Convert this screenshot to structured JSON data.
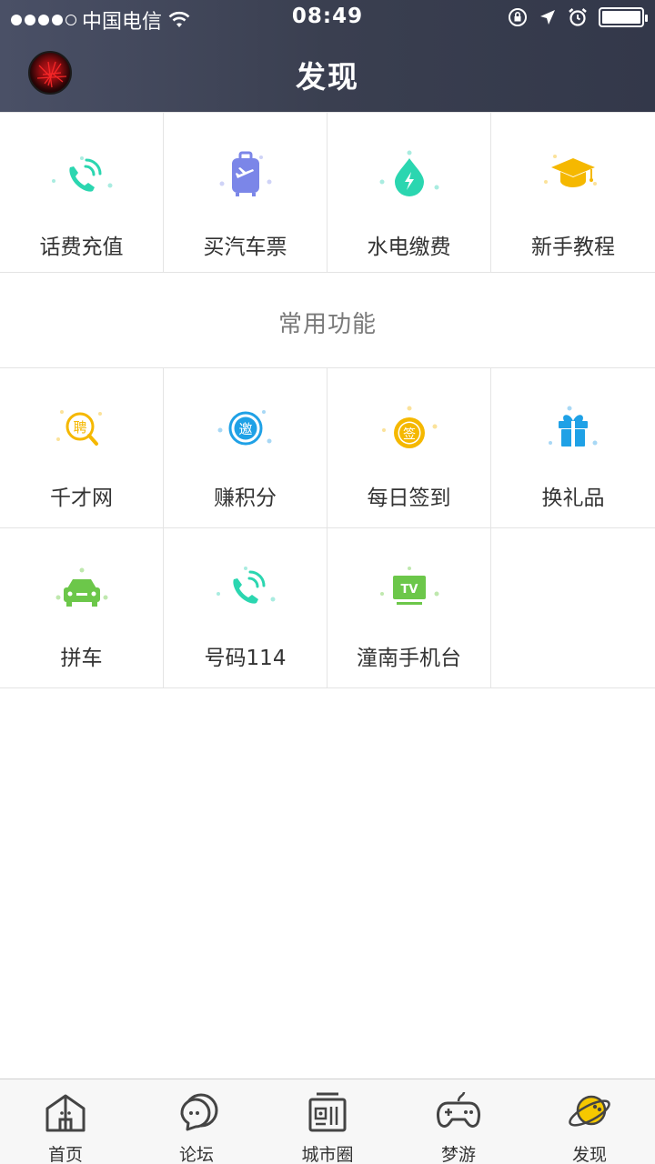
{
  "status_bar": {
    "carrier": "中国电信",
    "time": "08:49"
  },
  "header": {
    "title": "发现"
  },
  "top_services": [
    {
      "label": "话费充值",
      "icon": "phone-icon",
      "color": "#2bd6b0"
    },
    {
      "label": "买汽车票",
      "icon": "luggage-icon",
      "color": "#7b86e8"
    },
    {
      "label": "水电缴费",
      "icon": "water-drop-icon",
      "color": "#2bd6b0"
    },
    {
      "label": "新手教程",
      "icon": "graduation-cap-icon",
      "color": "#f5b800"
    }
  ],
  "section": {
    "title": "常用功能"
  },
  "common_functions": [
    {
      "label": "千才网",
      "icon": "recruit-search-icon",
      "glyph": "聘",
      "color": "#f5b800"
    },
    {
      "label": "赚积分",
      "icon": "invite-icon",
      "glyph": "邀",
      "color": "#1fa1e6"
    },
    {
      "label": "每日签到",
      "icon": "checkin-icon",
      "glyph": "签",
      "color": "#f5b800"
    },
    {
      "label": "换礼品",
      "icon": "gift-icon",
      "color": "#1fa1e6"
    },
    {
      "label": "拼车",
      "icon": "car-icon",
      "color": "#6cc74a"
    },
    {
      "label": "号码114",
      "icon": "phone-icon",
      "color": "#2bd6b0"
    },
    {
      "label": "潼南手机台",
      "icon": "tv-icon",
      "glyph": "TV",
      "color": "#6cc74a"
    }
  ],
  "tabbar": [
    {
      "label": "首页",
      "icon": "home-icon",
      "active": false
    },
    {
      "label": "论坛",
      "icon": "chat-bubble-icon",
      "active": false
    },
    {
      "label": "城市圈",
      "icon": "radio-icon",
      "active": false
    },
    {
      "label": "梦游",
      "icon": "gamepad-icon",
      "active": false
    },
    {
      "label": "发现",
      "icon": "planet-icon",
      "active": true,
      "color": "#f5c800"
    }
  ]
}
